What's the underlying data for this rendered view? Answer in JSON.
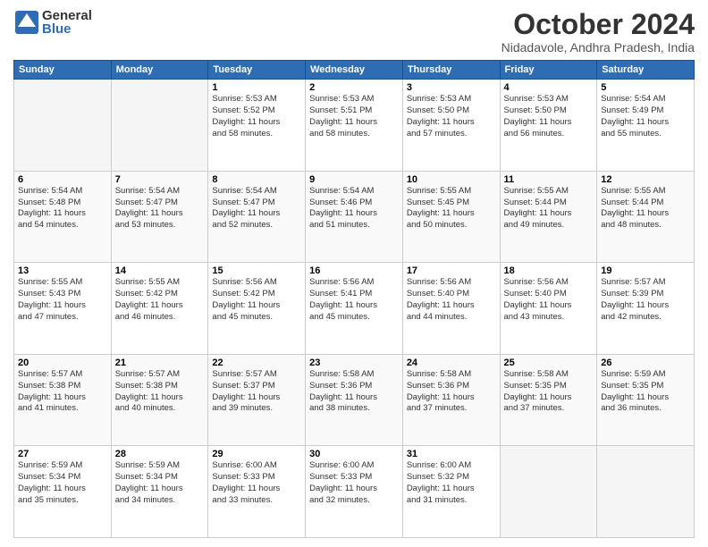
{
  "logo": {
    "general": "General",
    "blue": "Blue"
  },
  "header": {
    "month": "October 2024",
    "location": "Nidadavole, Andhra Pradesh, India"
  },
  "weekdays": [
    "Sunday",
    "Monday",
    "Tuesday",
    "Wednesday",
    "Thursday",
    "Friday",
    "Saturday"
  ],
  "weeks": [
    [
      {
        "day": "",
        "info": ""
      },
      {
        "day": "",
        "info": ""
      },
      {
        "day": "1",
        "info": "Sunrise: 5:53 AM\nSunset: 5:52 PM\nDaylight: 11 hours\nand 58 minutes."
      },
      {
        "day": "2",
        "info": "Sunrise: 5:53 AM\nSunset: 5:51 PM\nDaylight: 11 hours\nand 58 minutes."
      },
      {
        "day": "3",
        "info": "Sunrise: 5:53 AM\nSunset: 5:50 PM\nDaylight: 11 hours\nand 57 minutes."
      },
      {
        "day": "4",
        "info": "Sunrise: 5:53 AM\nSunset: 5:50 PM\nDaylight: 11 hours\nand 56 minutes."
      },
      {
        "day": "5",
        "info": "Sunrise: 5:54 AM\nSunset: 5:49 PM\nDaylight: 11 hours\nand 55 minutes."
      }
    ],
    [
      {
        "day": "6",
        "info": "Sunrise: 5:54 AM\nSunset: 5:48 PM\nDaylight: 11 hours\nand 54 minutes."
      },
      {
        "day": "7",
        "info": "Sunrise: 5:54 AM\nSunset: 5:47 PM\nDaylight: 11 hours\nand 53 minutes."
      },
      {
        "day": "8",
        "info": "Sunrise: 5:54 AM\nSunset: 5:47 PM\nDaylight: 11 hours\nand 52 minutes."
      },
      {
        "day": "9",
        "info": "Sunrise: 5:54 AM\nSunset: 5:46 PM\nDaylight: 11 hours\nand 51 minutes."
      },
      {
        "day": "10",
        "info": "Sunrise: 5:55 AM\nSunset: 5:45 PM\nDaylight: 11 hours\nand 50 minutes."
      },
      {
        "day": "11",
        "info": "Sunrise: 5:55 AM\nSunset: 5:44 PM\nDaylight: 11 hours\nand 49 minutes."
      },
      {
        "day": "12",
        "info": "Sunrise: 5:55 AM\nSunset: 5:44 PM\nDaylight: 11 hours\nand 48 minutes."
      }
    ],
    [
      {
        "day": "13",
        "info": "Sunrise: 5:55 AM\nSunset: 5:43 PM\nDaylight: 11 hours\nand 47 minutes."
      },
      {
        "day": "14",
        "info": "Sunrise: 5:55 AM\nSunset: 5:42 PM\nDaylight: 11 hours\nand 46 minutes."
      },
      {
        "day": "15",
        "info": "Sunrise: 5:56 AM\nSunset: 5:42 PM\nDaylight: 11 hours\nand 45 minutes."
      },
      {
        "day": "16",
        "info": "Sunrise: 5:56 AM\nSunset: 5:41 PM\nDaylight: 11 hours\nand 45 minutes."
      },
      {
        "day": "17",
        "info": "Sunrise: 5:56 AM\nSunset: 5:40 PM\nDaylight: 11 hours\nand 44 minutes."
      },
      {
        "day": "18",
        "info": "Sunrise: 5:56 AM\nSunset: 5:40 PM\nDaylight: 11 hours\nand 43 minutes."
      },
      {
        "day": "19",
        "info": "Sunrise: 5:57 AM\nSunset: 5:39 PM\nDaylight: 11 hours\nand 42 minutes."
      }
    ],
    [
      {
        "day": "20",
        "info": "Sunrise: 5:57 AM\nSunset: 5:38 PM\nDaylight: 11 hours\nand 41 minutes."
      },
      {
        "day": "21",
        "info": "Sunrise: 5:57 AM\nSunset: 5:38 PM\nDaylight: 11 hours\nand 40 minutes."
      },
      {
        "day": "22",
        "info": "Sunrise: 5:57 AM\nSunset: 5:37 PM\nDaylight: 11 hours\nand 39 minutes."
      },
      {
        "day": "23",
        "info": "Sunrise: 5:58 AM\nSunset: 5:36 PM\nDaylight: 11 hours\nand 38 minutes."
      },
      {
        "day": "24",
        "info": "Sunrise: 5:58 AM\nSunset: 5:36 PM\nDaylight: 11 hours\nand 37 minutes."
      },
      {
        "day": "25",
        "info": "Sunrise: 5:58 AM\nSunset: 5:35 PM\nDaylight: 11 hours\nand 37 minutes."
      },
      {
        "day": "26",
        "info": "Sunrise: 5:59 AM\nSunset: 5:35 PM\nDaylight: 11 hours\nand 36 minutes."
      }
    ],
    [
      {
        "day": "27",
        "info": "Sunrise: 5:59 AM\nSunset: 5:34 PM\nDaylight: 11 hours\nand 35 minutes."
      },
      {
        "day": "28",
        "info": "Sunrise: 5:59 AM\nSunset: 5:34 PM\nDaylight: 11 hours\nand 34 minutes."
      },
      {
        "day": "29",
        "info": "Sunrise: 6:00 AM\nSunset: 5:33 PM\nDaylight: 11 hours\nand 33 minutes."
      },
      {
        "day": "30",
        "info": "Sunrise: 6:00 AM\nSunset: 5:33 PM\nDaylight: 11 hours\nand 32 minutes."
      },
      {
        "day": "31",
        "info": "Sunrise: 6:00 AM\nSunset: 5:32 PM\nDaylight: 11 hours\nand 31 minutes."
      },
      {
        "day": "",
        "info": ""
      },
      {
        "day": "",
        "info": ""
      }
    ]
  ]
}
